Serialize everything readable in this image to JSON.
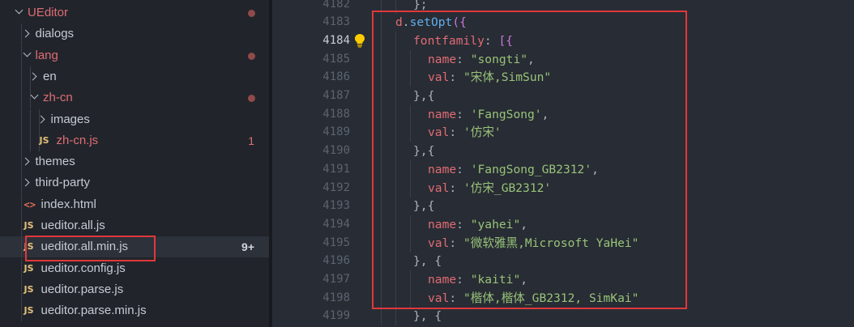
{
  "explorer": {
    "items": [
      {
        "label": "UEditor",
        "kind": "folder",
        "open": true,
        "modified": true,
        "red": true
      },
      {
        "label": "dialogs",
        "kind": "folder",
        "open": false
      },
      {
        "label": "lang",
        "kind": "folder",
        "open": true,
        "modified": true,
        "red": true
      },
      {
        "label": "en",
        "kind": "folder",
        "open": false
      },
      {
        "label": "zh-cn",
        "kind": "folder",
        "open": true,
        "modified": true,
        "red": true
      },
      {
        "label": "images",
        "kind": "folder",
        "open": false
      },
      {
        "label": "zh-cn.js",
        "kind": "js",
        "badge": "1",
        "red": true
      },
      {
        "label": "themes",
        "kind": "folder",
        "open": false
      },
      {
        "label": "third-party",
        "kind": "folder",
        "open": false
      },
      {
        "label": "index.html",
        "kind": "html"
      },
      {
        "label": "ueditor.all.js",
        "kind": "js"
      },
      {
        "label": "ueditor.all.min.js",
        "kind": "js",
        "badge": "9+",
        "selected": true
      },
      {
        "label": "ueditor.config.js",
        "kind": "js"
      },
      {
        "label": "ueditor.parse.js",
        "kind": "js"
      },
      {
        "label": "ueditor.parse.min.js",
        "kind": "js"
      }
    ],
    "js_icon_text": "JS",
    "html_icon_text": "<>"
  },
  "editor": {
    "active_line": "4184",
    "line_numbers": [
      "4182",
      "4183",
      "4184",
      "4185",
      "4186",
      "4187",
      "4188",
      "4189",
      "4190",
      "4191",
      "4192",
      "4193",
      "4194",
      "4195",
      "4196",
      "4197",
      "4198",
      "4199"
    ],
    "lightbulb_icon": "lightbulb-icon",
    "lines": [
      {
        "indent": 3,
        "tokens": [
          {
            "t": "};",
            "c": "pun"
          }
        ]
      },
      {
        "indent": 2,
        "tokens": [
          {
            "t": "d",
            "c": "key"
          },
          {
            "t": ".",
            "c": "pun"
          },
          {
            "t": "setOpt",
            "c": "fn"
          },
          {
            "t": "({",
            "c": "brk"
          }
        ]
      },
      {
        "indent": 3,
        "tokens": [
          {
            "t": "fontfamily",
            "c": "key"
          },
          {
            "t": ": ",
            "c": "pun"
          },
          {
            "t": "[{",
            "c": "brk"
          }
        ]
      },
      {
        "indent": 4,
        "tokens": [
          {
            "t": "name",
            "c": "key"
          },
          {
            "t": ": ",
            "c": "pun"
          },
          {
            "t": "\"songti\"",
            "c": "str"
          },
          {
            "t": ",",
            "c": "pun"
          }
        ]
      },
      {
        "indent": 4,
        "tokens": [
          {
            "t": "val",
            "c": "key"
          },
          {
            "t": ": ",
            "c": "pun"
          },
          {
            "t": "\"宋体,SimSun\"",
            "c": "str"
          }
        ]
      },
      {
        "indent": 3,
        "tokens": [
          {
            "t": "},{",
            "c": "pun"
          }
        ]
      },
      {
        "indent": 4,
        "tokens": [
          {
            "t": "name",
            "c": "key"
          },
          {
            "t": ": ",
            "c": "pun"
          },
          {
            "t": "'FangSong'",
            "c": "str"
          },
          {
            "t": ",",
            "c": "pun"
          }
        ]
      },
      {
        "indent": 4,
        "tokens": [
          {
            "t": "val",
            "c": "key"
          },
          {
            "t": ": ",
            "c": "pun"
          },
          {
            "t": "'仿宋'",
            "c": "str"
          }
        ]
      },
      {
        "indent": 3,
        "tokens": [
          {
            "t": "},{",
            "c": "pun"
          }
        ]
      },
      {
        "indent": 4,
        "tokens": [
          {
            "t": "name",
            "c": "key"
          },
          {
            "t": ": ",
            "c": "pun"
          },
          {
            "t": "'FangSong_GB2312'",
            "c": "str"
          },
          {
            "t": ",",
            "c": "pun"
          }
        ]
      },
      {
        "indent": 4,
        "tokens": [
          {
            "t": "val",
            "c": "key"
          },
          {
            "t": ": ",
            "c": "pun"
          },
          {
            "t": "'仿宋_GB2312'",
            "c": "str"
          }
        ]
      },
      {
        "indent": 3,
        "tokens": [
          {
            "t": "},{",
            "c": "pun"
          }
        ]
      },
      {
        "indent": 4,
        "tokens": [
          {
            "t": "name",
            "c": "key"
          },
          {
            "t": ": ",
            "c": "pun"
          },
          {
            "t": "\"yahei\"",
            "c": "str"
          },
          {
            "t": ",",
            "c": "pun"
          }
        ]
      },
      {
        "indent": 4,
        "tokens": [
          {
            "t": "val",
            "c": "key"
          },
          {
            "t": ": ",
            "c": "pun"
          },
          {
            "t": "\"微软雅黑,Microsoft YaHei\"",
            "c": "str"
          }
        ]
      },
      {
        "indent": 3,
        "tokens": [
          {
            "t": "}, {",
            "c": "pun"
          }
        ]
      },
      {
        "indent": 4,
        "tokens": [
          {
            "t": "name",
            "c": "key"
          },
          {
            "t": ": ",
            "c": "pun"
          },
          {
            "t": "\"kaiti\"",
            "c": "str"
          },
          {
            "t": ",",
            "c": "pun"
          }
        ]
      },
      {
        "indent": 4,
        "tokens": [
          {
            "t": "val",
            "c": "key"
          },
          {
            "t": ": ",
            "c": "pun"
          },
          {
            "t": "\"楷体,楷体_GB2312, SimKai\"",
            "c": "str"
          }
        ]
      },
      {
        "indent": 3,
        "tokens": [
          {
            "t": "}, {",
            "c": "pun"
          }
        ]
      }
    ]
  },
  "colors": {
    "highlight_box": "#e0383b",
    "folder_modified": "#e06c75",
    "modified_dot": "#8f4a49"
  }
}
